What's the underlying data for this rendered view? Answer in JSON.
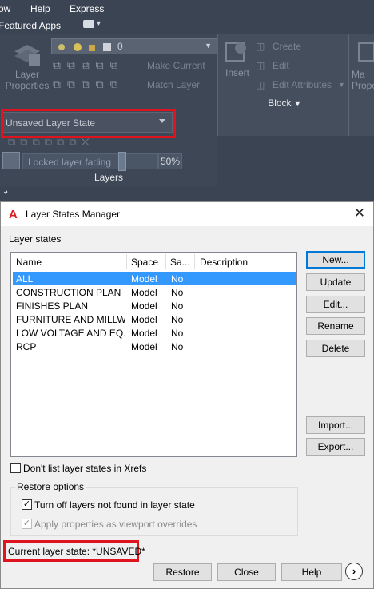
{
  "ribbon": {
    "menu": [
      "ow",
      "Help",
      "Express"
    ],
    "featured_apps": "Featured Apps",
    "layer_properties": [
      "Layer",
      "Properties"
    ],
    "layer_value": "0",
    "make_current": "Make Current",
    "match_layer": "Match Layer",
    "insert": "Insert",
    "create": "Create",
    "edit": "Edit",
    "edit_attributes": "Edit Attributes",
    "block_title": "Block",
    "manage_partial": [
      "Ma",
      "Prope"
    ],
    "layer_state": "Unsaved Layer State",
    "locked_fading": "Locked layer fading",
    "fading_pct": "50%",
    "fading_level": 0.5,
    "layers_title": "Layers"
  },
  "dialog": {
    "title": "Layer States Manager",
    "layer_states_label": "Layer states",
    "columns": [
      "Name",
      "Space",
      "Sa...",
      "Description"
    ],
    "rows": [
      {
        "name": "ALL",
        "space": "Model",
        "saved": "No",
        "description": ""
      },
      {
        "name": "CONSTRUCTION PLAN",
        "space": "Model",
        "saved": "No",
        "description": ""
      },
      {
        "name": "FINISHES PLAN",
        "space": "Model",
        "saved": "No",
        "description": ""
      },
      {
        "name": "FURNITURE AND MILLW...",
        "space": "Model",
        "saved": "No",
        "description": ""
      },
      {
        "name": "LOW VOLTAGE AND EQ...",
        "space": "Model",
        "saved": "No",
        "description": ""
      },
      {
        "name": "RCP",
        "space": "Model",
        "saved": "No",
        "description": ""
      }
    ],
    "buttons": {
      "new": "New...",
      "update": "Update",
      "edit": "Edit...",
      "rename": "Rename",
      "delete": "Delete",
      "import": "Import...",
      "export": "Export..."
    },
    "dont_list_xrefs": "Don't list layer states in Xrefs",
    "restore_options_label": "Restore options",
    "turn_off_layers": "Turn off layers not found in layer state",
    "apply_viewport": "Apply properties as viewport overrides",
    "current_state": "Current layer state: *UNSAVED*",
    "bottom": {
      "restore": "Restore",
      "close": "Close",
      "help": "Help",
      "more": "›"
    }
  },
  "colors": {
    "highlight": "#e0141e",
    "selection": "#3399ff",
    "ribbon_bg": "#3b4453"
  }
}
